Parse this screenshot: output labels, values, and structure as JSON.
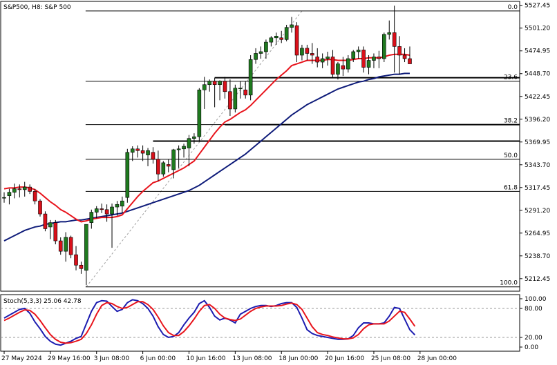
{
  "title": "S&P500, H8:  S&P 500",
  "colors": {
    "bull": "#1f7a1f",
    "bear": "#d9101a",
    "ma_fast": "#e8141c",
    "ma_slow": "#0f1c7a",
    "stoch_k": "#1c1cb0",
    "stoch_d": "#e8141c",
    "fib": "#000000",
    "grid_dash": "#9a9a9a",
    "fib_trend": "#a0a0a0"
  },
  "stoch_label": "Stoch(5,3,3) 25.06 42.78",
  "chart_data": [
    {
      "type": "candlestick",
      "title": "S&P500, H8:  S&P 500",
      "ylim": [
        5198,
        5532
      ],
      "y_ticks": [
        "5527.45",
        "5501.20",
        "5474.95",
        "5448.70",
        "5422.45",
        "5396.20",
        "5369.95",
        "5343.70",
        "5317.45",
        "5291.20",
        "5264.95",
        "5238.70",
        "5212.45"
      ],
      "x_labels": [
        {
          "i": 0,
          "label": "27 May 2024"
        },
        {
          "i": 9,
          "label": "29 May 16:00"
        },
        {
          "i": 18,
          "label": "3 Jun 08:00"
        },
        {
          "i": 27,
          "label": "6 Jun 00:00"
        },
        {
          "i": 36,
          "label": "10 Jun 16:00"
        },
        {
          "i": 45,
          "label": "13 Jun 08:00"
        },
        {
          "i": 54,
          "label": "18 Jun 00:00"
        },
        {
          "i": 63,
          "label": "20 Jun 16:00"
        },
        {
          "i": 72,
          "label": "25 Jun 08:00"
        },
        {
          "i": 81,
          "label": "28 Jun 00:00"
        }
      ],
      "ohlc": [
        [
          5306,
          5312,
          5300,
          5306
        ],
        [
          5308,
          5316,
          5298,
          5312
        ],
        [
          5312,
          5322,
          5305,
          5316
        ],
        [
          5316,
          5321,
          5306,
          5315
        ],
        [
          5315,
          5324,
          5307,
          5318
        ],
        [
          5318,
          5321,
          5310,
          5313
        ],
        [
          5313,
          5316,
          5298,
          5302
        ],
        [
          5302,
          5304,
          5284,
          5287
        ],
        [
          5287,
          5290,
          5267,
          5270
        ],
        [
          5272,
          5280,
          5258,
          5277
        ],
        [
          5277,
          5280,
          5252,
          5256
        ],
        [
          5256,
          5260,
          5240,
          5244
        ],
        [
          5244,
          5266,
          5232,
          5260
        ],
        [
          5260,
          5262,
          5236,
          5240
        ],
        [
          5240,
          5250,
          5222,
          5228
        ],
        [
          5228,
          5232,
          5218,
          5224
        ],
        [
          5222,
          5275,
          5205,
          5275
        ],
        [
          5277,
          5292,
          5270,
          5289
        ],
        [
          5289,
          5296,
          5282,
          5293
        ],
        [
          5293,
          5299,
          5288,
          5292
        ],
        [
          5292,
          5298,
          5278,
          5287
        ],
        [
          5287,
          5299,
          5248,
          5295
        ],
        [
          5295,
          5302,
          5285,
          5298
        ],
        [
          5296,
          5307,
          5288,
          5302
        ],
        [
          5306,
          5362,
          5300,
          5358
        ],
        [
          5358,
          5365,
          5348,
          5362
        ],
        [
          5362,
          5366,
          5352,
          5360
        ],
        [
          5360,
          5366,
          5348,
          5357
        ],
        [
          5355,
          5363,
          5342,
          5360
        ],
        [
          5358,
          5364,
          5345,
          5350
        ],
        [
          5350,
          5360,
          5325,
          5333
        ],
        [
          5333,
          5348,
          5330,
          5346
        ],
        [
          5344,
          5350,
          5335,
          5342
        ],
        [
          5338,
          5362,
          5328,
          5361
        ],
        [
          5361,
          5366,
          5340,
          5362
        ],
        [
          5362,
          5368,
          5352,
          5365
        ],
        [
          5363,
          5378,
          5342,
          5374
        ],
        [
          5374,
          5380,
          5368,
          5376
        ],
        [
          5376,
          5432,
          5370,
          5430
        ],
        [
          5430,
          5445,
          5408,
          5436
        ],
        [
          5436,
          5442,
          5428,
          5440
        ],
        [
          5440,
          5444,
          5410,
          5436
        ],
        [
          5436,
          5441,
          5418,
          5440
        ],
        [
          5440,
          5445,
          5420,
          5428
        ],
        [
          5428,
          5442,
          5400,
          5408
        ],
        [
          5408,
          5436,
          5404,
          5432
        ],
        [
          5432,
          5440,
          5420,
          5432
        ],
        [
          5430,
          5440,
          5420,
          5424
        ],
        [
          5424,
          5470,
          5418,
          5465
        ],
        [
          5465,
          5478,
          5460,
          5472
        ],
        [
          5472,
          5480,
          5466,
          5474
        ],
        [
          5474,
          5488,
          5466,
          5485
        ],
        [
          5485,
          5492,
          5480,
          5490
        ],
        [
          5490,
          5496,
          5482,
          5492
        ],
        [
          5490,
          5498,
          5484,
          5488
        ],
        [
          5488,
          5505,
          5486,
          5502
        ],
        [
          5502,
          5514,
          5496,
          5505
        ],
        [
          5504,
          5508,
          5462,
          5470
        ],
        [
          5470,
          5482,
          5464,
          5478
        ],
        [
          5478,
          5482,
          5464,
          5472
        ],
        [
          5472,
          5484,
          5460,
          5470
        ],
        [
          5468,
          5478,
          5456,
          5462
        ],
        [
          5462,
          5472,
          5455,
          5466
        ],
        [
          5466,
          5474,
          5458,
          5468
        ],
        [
          5468,
          5476,
          5444,
          5448
        ],
        [
          5448,
          5462,
          5442,
          5460
        ],
        [
          5458,
          5468,
          5446,
          5454
        ],
        [
          5454,
          5470,
          5450,
          5466
        ],
        [
          5466,
          5476,
          5462,
          5474
        ],
        [
          5474,
          5480,
          5466,
          5476
        ],
        [
          5476,
          5480,
          5450,
          5456
        ],
        [
          5456,
          5470,
          5448,
          5464
        ],
        [
          5464,
          5472,
          5455,
          5468
        ],
        [
          5468,
          5475,
          5455,
          5466
        ],
        [
          5466,
          5496,
          5462,
          5494
        ],
        [
          5494,
          5510,
          5488,
          5496
        ],
        [
          5496,
          5527,
          5450,
          5480
        ],
        [
          5480,
          5492,
          5448,
          5470
        ],
        [
          5470,
          5478,
          5462,
          5466
        ],
        [
          5466,
          5480,
          5460,
          5460
        ]
      ],
      "ma_fast": [
        5316,
        5317,
        5317,
        5318,
        5318,
        5317,
        5315,
        5311,
        5306,
        5301,
        5297,
        5292,
        5289,
        5285,
        5281,
        5278,
        5279,
        5281,
        5282,
        5283,
        5283,
        5283,
        5284,
        5286,
        5293,
        5300,
        5307,
        5313,
        5318,
        5323,
        5325,
        5328,
        5331,
        5334,
        5337,
        5340,
        5344,
        5348,
        5356,
        5364,
        5372,
        5380,
        5387,
        5393,
        5396,
        5400,
        5404,
        5407,
        5412,
        5418,
        5424,
        5430,
        5436,
        5442,
        5447,
        5452,
        5458,
        5460,
        5462,
        5464,
        5464,
        5464,
        5464,
        5465,
        5465,
        5464,
        5464,
        5464,
        5465,
        5466,
        5466,
        5467,
        5467,
        5467,
        5468,
        5470,
        5471,
        5471,
        5471,
        5470
      ],
      "ma_slow": [
        5256,
        5259,
        5262,
        5265,
        5268,
        5270,
        5272,
        5273,
        5275,
        5276,
        5277,
        5278,
        5278,
        5279,
        5280,
        5280,
        5281,
        5282,
        5283,
        5284,
        5285,
        5286,
        5287,
        5288,
        5290,
        5292,
        5294,
        5296,
        5298,
        5300,
        5302,
        5304,
        5306,
        5308,
        5310,
        5312,
        5314,
        5317,
        5320,
        5324,
        5328,
        5332,
        5336,
        5340,
        5344,
        5348,
        5352,
        5356,
        5361,
        5366,
        5371,
        5376,
        5381,
        5386,
        5391,
        5396,
        5401,
        5405,
        5409,
        5413,
        5416,
        5419,
        5422,
        5425,
        5428,
        5431,
        5433,
        5435,
        5437,
        5439,
        5440,
        5442,
        5443,
        5445,
        5446,
        5447,
        5448,
        5448,
        5449,
        5449
      ],
      "fib_levels": [
        {
          "label": "0.0",
          "value": 5521
        },
        {
          "label": "23.6",
          "value": 5440
        },
        {
          "label": "38.2",
          "value": 5390
        },
        {
          "label": "50.0",
          "value": 5350
        },
        {
          "label": "61.8",
          "value": 5313
        },
        {
          "label": "100.0",
          "value": 5203
        }
      ],
      "support_lines": [
        {
          "value": 5444
        },
        {
          "value": 5390
        },
        {
          "value": 5371
        }
      ]
    },
    {
      "type": "line",
      "title": "Stoch(5,3,3) 25.06 42.78",
      "ylim": [
        0,
        100
      ],
      "y_ticks": [
        "100.00",
        "80.00",
        "20.00",
        "0.00"
      ],
      "series": [
        {
          "name": "K",
          "values": [
            60,
            66,
            72,
            78,
            80,
            70,
            52,
            38,
            22,
            12,
            6,
            4,
            8,
            12,
            18,
            22,
            48,
            74,
            92,
            96,
            95,
            84,
            74,
            78,
            92,
            98,
            96,
            90,
            80,
            64,
            42,
            26,
            20,
            22,
            30,
            46,
            60,
            72,
            90,
            96,
            82,
            64,
            56,
            60,
            56,
            50,
            68,
            74,
            80,
            84,
            86,
            86,
            84,
            86,
            90,
            92,
            92,
            82,
            60,
            36,
            28,
            24,
            22,
            20,
            18,
            16,
            16,
            17,
            24,
            40,
            50,
            50,
            48,
            48,
            50,
            64,
            82,
            80,
            58,
            36,
            25
          ]
        },
        {
          "name": "D",
          "values": [
            55,
            60,
            66,
            72,
            77,
            76,
            68,
            55,
            40,
            26,
            16,
            10,
            8,
            9,
            12,
            16,
            28,
            46,
            68,
            86,
            92,
            90,
            84,
            80,
            82,
            88,
            94,
            94,
            88,
            78,
            62,
            44,
            30,
            24,
            24,
            32,
            44,
            58,
            74,
            86,
            88,
            80,
            68,
            60,
            57,
            55,
            58,
            66,
            74,
            80,
            83,
            85,
            85,
            85,
            86,
            89,
            91,
            88,
            78,
            60,
            42,
            30,
            26,
            24,
            21,
            19,
            17,
            17,
            19,
            26,
            38,
            46,
            48,
            48,
            48,
            54,
            64,
            74,
            72,
            58,
            43
          ]
        }
      ]
    }
  ]
}
